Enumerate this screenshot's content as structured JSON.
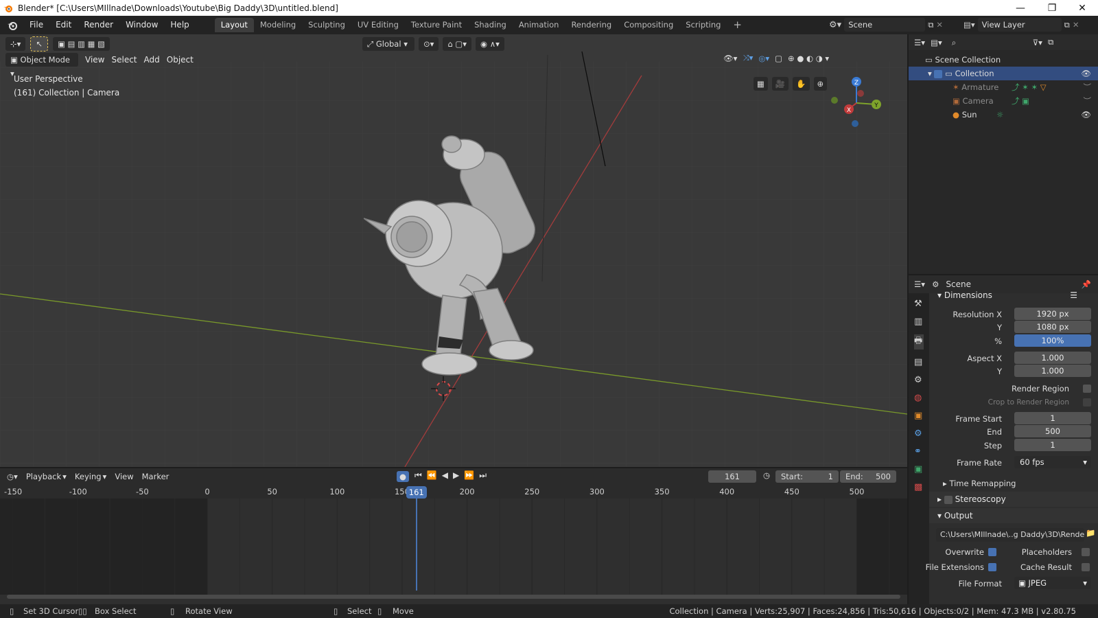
{
  "window": {
    "title": "Blender* [C:\\Users\\MIllnade\\Downloads\\Youtube\\Big Daddy\\3D\\untitled.blend]",
    "min": "—",
    "max": "❐",
    "close": "✕"
  },
  "menus": [
    "File",
    "Edit",
    "Render",
    "Window",
    "Help"
  ],
  "workspaces": [
    "Layout",
    "Modeling",
    "Sculpting",
    "UV Editing",
    "Texture Paint",
    "Shading",
    "Animation",
    "Rendering",
    "Compositing",
    "Scripting"
  ],
  "add_workspace": "+",
  "scene_name": "Scene",
  "view_layer": "View Layer",
  "viewport": {
    "transform_orientation": "Global",
    "mode": "Object Mode",
    "header_menus": [
      "View",
      "Select",
      "Add",
      "Object"
    ],
    "overlay_title": "User Perspective",
    "overlay_subtitle": "(161) Collection | Camera",
    "gizmo": {
      "x": "X",
      "y": "Y",
      "z": "Z"
    }
  },
  "outliner": {
    "scene_collection": "Scene Collection",
    "collection": "Collection",
    "items": [
      "Armature",
      "Camera",
      "Sun"
    ]
  },
  "properties": {
    "context": "Scene",
    "dimensions": {
      "title": "Dimensions",
      "res_x_label": "Resolution X",
      "res_x": "1920 px",
      "res_y_label": "Y",
      "res_y": "1080 px",
      "pct_label": "%",
      "pct": "100%",
      "aspect_x_label": "Aspect X",
      "aspect_x": "1.000",
      "aspect_y_label": "Y",
      "aspect_y": "1.000",
      "render_region": "Render Region",
      "crop": "Crop to Render Region",
      "frame_start_label": "Frame Start",
      "frame_start": "1",
      "end_label": "End",
      "end": "500",
      "step_label": "Step",
      "step": "1",
      "frame_rate_label": "Frame Rate",
      "frame_rate": "60 fps",
      "time_remapping": "Time Remapping"
    },
    "stereoscopy": "Stereoscopy",
    "output": {
      "title": "Output",
      "path": "C:\\Users\\MIllnade\\..g Daddy\\3D\\Render\\",
      "overwrite": "Overwrite",
      "placeholders": "Placeholders",
      "file_extensions": "File Extensions",
      "cache_result": "Cache Result",
      "file_format_label": "File Format",
      "file_format": "JPEG"
    }
  },
  "timeline": {
    "menus": [
      "Playback",
      "Keying",
      "View",
      "Marker"
    ],
    "current_frame": "161",
    "start_label": "Start:",
    "start": "1",
    "end_label": "End:",
    "end": "500",
    "ruler": [
      "-150",
      "-100",
      "-50",
      "0",
      "50",
      "100",
      "150",
      "200",
      "250",
      "300",
      "350",
      "400",
      "450",
      "500"
    ]
  },
  "status": {
    "left": [
      "Set 3D Cursor",
      "Box Select",
      "Rotate View",
      "Select",
      "Move"
    ],
    "right": "Collection | Camera | Verts:25,907 | Faces:24,856 | Tris:50,616 | Objects:0/2 | Mem: 47.3 MB | v2.80.75"
  }
}
